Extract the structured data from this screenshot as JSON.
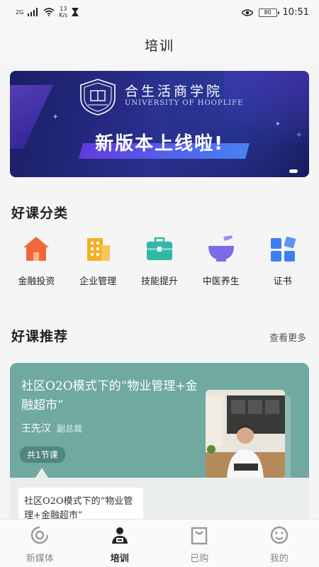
{
  "status_bar": {
    "network_type": "2G",
    "speed_value": "13",
    "speed_unit": "K/s",
    "battery": "80",
    "time": "10:51",
    "icons": [
      "signal-icon",
      "wifi-icon",
      "hourglass-icon",
      "eye-icon",
      "battery-icon"
    ]
  },
  "header": {
    "title": "培训"
  },
  "banner": {
    "school_name": "合生活商学院",
    "school_english": "UNIVERSITY OF HOOPLIFE",
    "slogan": "新版本上线啦!"
  },
  "categories": {
    "title": "好课分类",
    "items": [
      {
        "label": "金融投资",
        "icon": "house-icon",
        "color": "#f0683a"
      },
      {
        "label": "企业管理",
        "icon": "building-icon",
        "color": "#f5b020"
      },
      {
        "label": "技能提升",
        "icon": "briefcase-icon",
        "color": "#2fb8a6"
      },
      {
        "label": "中医养生",
        "icon": "mortar-icon",
        "color": "#7a6ce8"
      },
      {
        "label": "证书",
        "icon": "apps-icon",
        "color": "#3c7ff0"
      }
    ]
  },
  "recommend": {
    "title": "好课推荐",
    "more_label": "查看更多",
    "course": {
      "title": "社区O2O模式下的“物业管理+金融超市”",
      "teacher": "王先汉",
      "teacher_role": "副总裁",
      "lesson_count": "共1节课",
      "lesson_title": "社区O2O模式下的“物业管理+金融超市”"
    }
  },
  "tabbar": {
    "items": [
      {
        "label": "新媒体",
        "icon": "media-icon"
      },
      {
        "label": "培训",
        "icon": "training-icon",
        "active": true
      },
      {
        "label": "已购",
        "icon": "bag-icon"
      },
      {
        "label": "我的",
        "icon": "smile-icon"
      }
    ]
  },
  "colors": {
    "accent": "#6fa9a0",
    "banner_bg": "#1f236e"
  }
}
